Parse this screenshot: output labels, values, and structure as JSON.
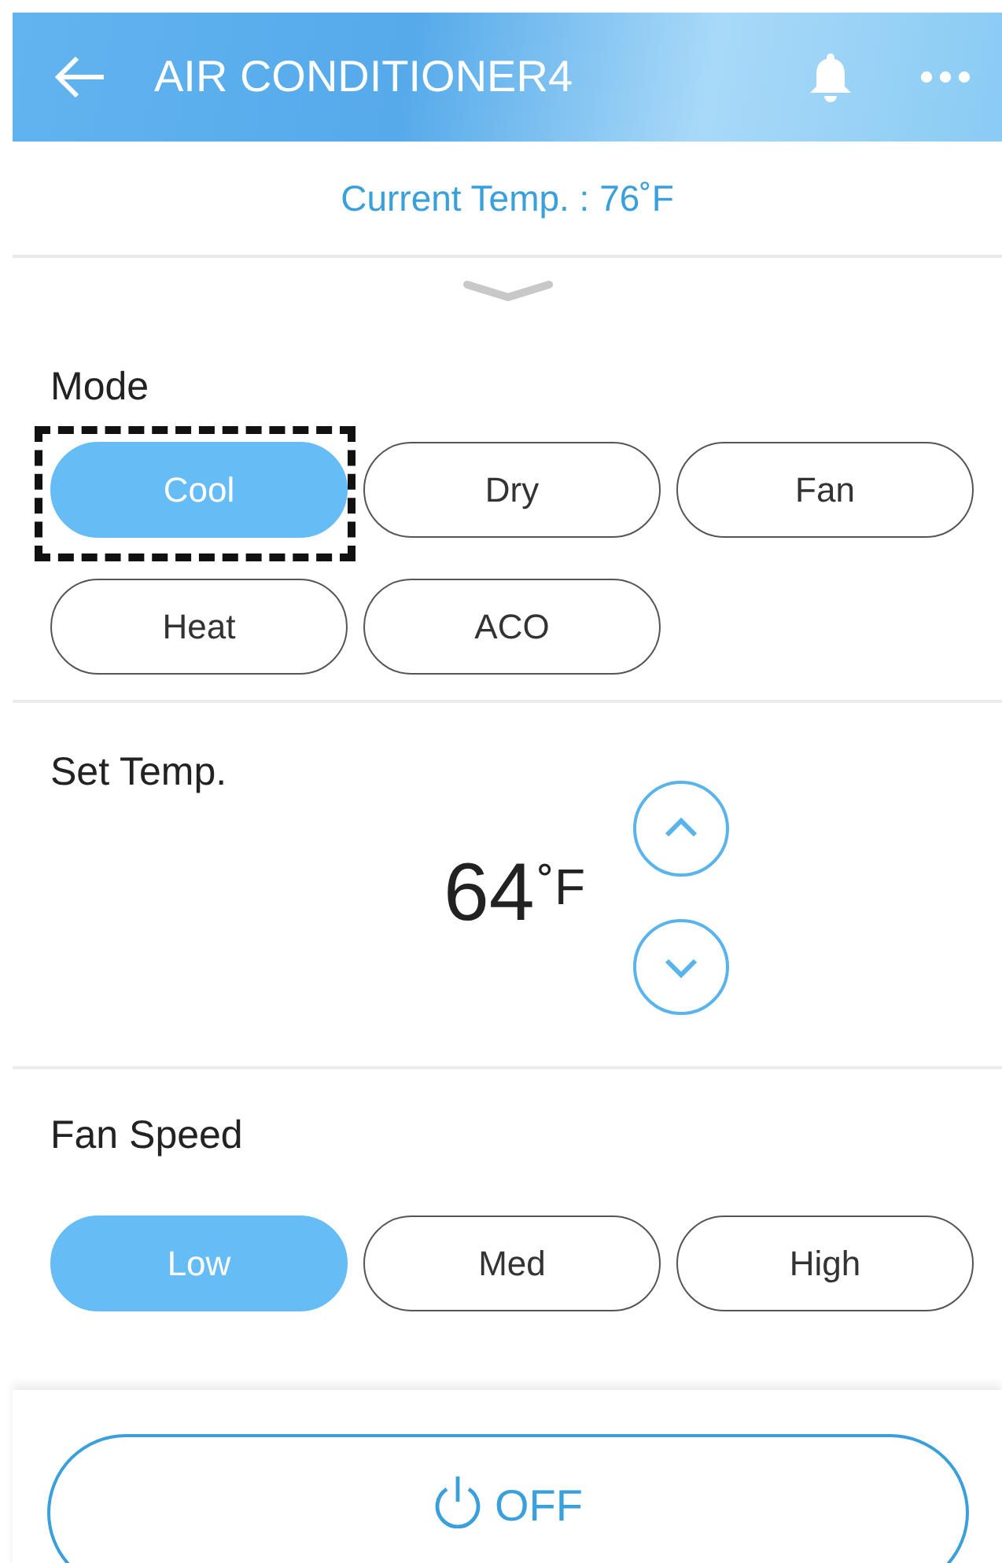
{
  "header": {
    "title": "AIR CONDITIONER4"
  },
  "current_temp": "Current Temp. : 76˚F",
  "mode": {
    "label": "Mode",
    "options": [
      {
        "label": "Cool",
        "selected": true,
        "focused": true
      },
      {
        "label": "Dry",
        "selected": false,
        "focused": false
      },
      {
        "label": "Fan",
        "selected": false,
        "focused": false
      },
      {
        "label": "Heat",
        "selected": false,
        "focused": false
      },
      {
        "label": "ACO",
        "selected": false,
        "focused": false
      }
    ]
  },
  "set_temp": {
    "label": "Set Temp.",
    "value": "64",
    "unit": "˚F"
  },
  "fan_speed": {
    "label": "Fan Speed",
    "options": [
      {
        "label": "Low",
        "selected": true
      },
      {
        "label": "Med",
        "selected": false
      },
      {
        "label": "High",
        "selected": false
      }
    ]
  },
  "power_button": {
    "label": "OFF"
  }
}
